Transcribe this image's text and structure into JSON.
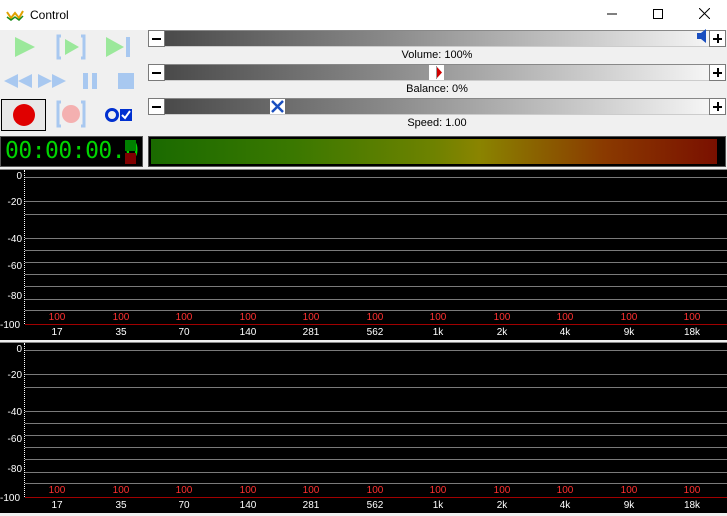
{
  "window": {
    "title": "Control"
  },
  "sliders": {
    "volume": {
      "label": "Volume: 100%",
      "level": 1.0
    },
    "balance": {
      "label": "Balance: 0%",
      "level": 0.5
    },
    "speed": {
      "label": "Speed: 1.00",
      "level": 0.2
    }
  },
  "time_display": {
    "time": "00:00:00.0"
  },
  "colors": {
    "time_text": "#00d400",
    "indicator_top": "#008000",
    "indicator_bottom": "#800000",
    "play_green": "#9be89b",
    "transport_blue": "#a8c8f0",
    "record_red": "#e00000"
  },
  "icons": [
    "app-icon",
    "minimize-icon",
    "maximize-icon",
    "close-icon",
    "play-icon",
    "play-loop-icon",
    "skip-end-icon",
    "rewind-icon",
    "fast-forward-icon",
    "pause-icon",
    "stop-icon",
    "record-icon",
    "record-loop-icon",
    "record-options-icon",
    "speaker-icon"
  ],
  "spectrum": {
    "db_labels": [
      "0",
      "-20",
      "-40",
      "-60",
      "-80",
      "-100"
    ],
    "band_values": [
      "100",
      "100",
      "100",
      "100",
      "100",
      "100",
      "100",
      "100",
      "100",
      "100",
      "100"
    ],
    "frequencies": [
      "17",
      "35",
      "70",
      "140",
      "281",
      "562",
      "1k",
      "2k",
      "4k",
      "9k",
      "18k"
    ]
  }
}
